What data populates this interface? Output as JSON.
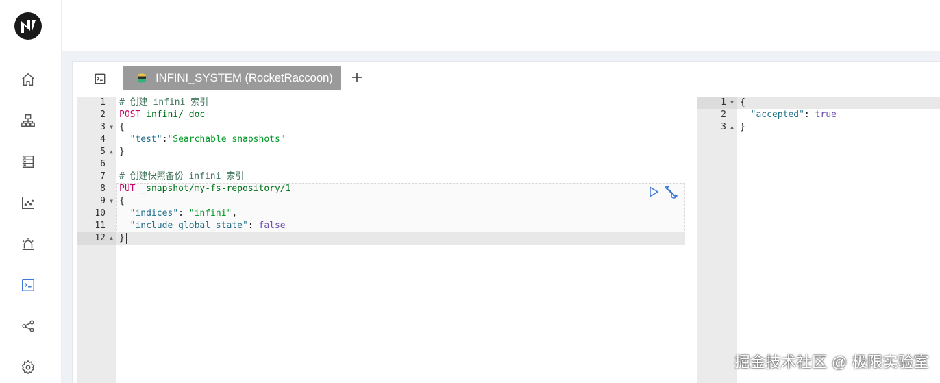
{
  "colors": {
    "accent": "#3e78d8",
    "tab_bg": "#9a9a9a",
    "gutter": "#ebebeb"
  },
  "sidebar": {
    "logo": "infini-logo",
    "items": [
      {
        "icon": "home-icon"
      },
      {
        "icon": "cluster-icon"
      },
      {
        "icon": "database-icon"
      },
      {
        "icon": "chart-icon"
      },
      {
        "icon": "alarm-icon"
      },
      {
        "icon": "console-icon",
        "active": true
      },
      {
        "icon": "share-icon"
      },
      {
        "icon": "settings-icon"
      }
    ]
  },
  "tabs": {
    "console_icon": "terminal-icon",
    "active_label": "INFINI_SYSTEM (RocketRaccoon)",
    "add_label": "+"
  },
  "request_editor": {
    "line_numbers": [
      "1",
      "2",
      "3",
      "4",
      "5",
      "6",
      "7",
      "8",
      "9",
      "10",
      "11",
      "12"
    ],
    "lines": [
      [
        {
          "t": "# 创建 infini 索引",
          "c": "c-comment"
        }
      ],
      [
        {
          "t": "POST ",
          "c": "c-method"
        },
        {
          "t": "infini/_doc",
          "c": "c-url"
        }
      ],
      [
        {
          "t": "{",
          "c": "c-dark"
        }
      ],
      [
        {
          "t": "  \"test\"",
          "c": "c-key"
        },
        {
          "t": ":",
          "c": "c-dark"
        },
        {
          "t": "\"Searchable snapshots\"",
          "c": "c-str"
        }
      ],
      [
        {
          "t": "}",
          "c": "c-dark"
        }
      ],
      [
        {
          "t": "",
          "c": "c-dark"
        }
      ],
      [
        {
          "t": "# 创建快照备份 infini 索引",
          "c": "c-comment"
        }
      ],
      [
        {
          "t": "PUT ",
          "c": "c-method"
        },
        {
          "t": "_snapshot/my-fs-repository/1",
          "c": "c-url"
        }
      ],
      [
        {
          "t": "{",
          "c": "c-dark"
        }
      ],
      [
        {
          "t": "  \"indices\"",
          "c": "c-key"
        },
        {
          "t": ": ",
          "c": "c-dark"
        },
        {
          "t": "\"infini\"",
          "c": "c-str"
        },
        {
          "t": ",",
          "c": "c-dark"
        }
      ],
      [
        {
          "t": "  \"include_global_state\"",
          "c": "c-key"
        },
        {
          "t": ": ",
          "c": "c-dark"
        },
        {
          "t": "false",
          "c": "c-bool"
        }
      ],
      [
        {
          "t": "}",
          "c": "c-dark"
        }
      ]
    ],
    "folds": {
      "3": "▼",
      "5": "▲",
      "9": "▼",
      "12": "▲"
    },
    "active_line": 12
  },
  "response_editor": {
    "line_numbers": [
      "1",
      "2",
      "3"
    ],
    "lines": [
      [
        {
          "t": "{",
          "c": "c-dark"
        }
      ],
      [
        {
          "t": "  \"accepted\"",
          "c": "c-key"
        },
        {
          "t": ": ",
          "c": "c-dark"
        },
        {
          "t": "true",
          "c": "c-bool"
        }
      ],
      [
        {
          "t": "}",
          "c": "c-dark"
        }
      ]
    ],
    "folds": {
      "1": "▼",
      "3": "▲"
    },
    "active_line": 1
  },
  "actions": {
    "run_icon": "play-icon",
    "tools_icon": "wrench-icon"
  },
  "watermark": "掘金技术社区 @ 极限实验室"
}
